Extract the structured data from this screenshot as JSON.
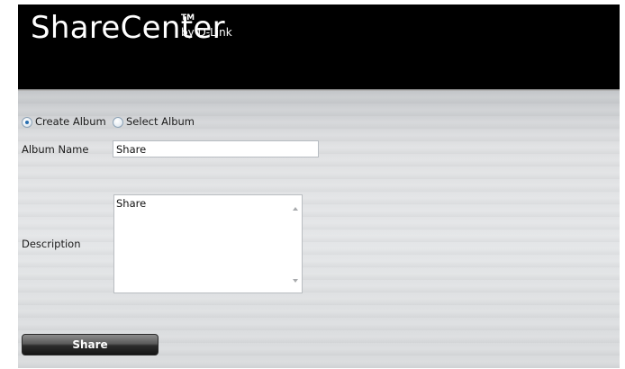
{
  "header": {
    "logo_main": "ShareCenter",
    "logo_tm": "TM",
    "logo_by": "by D-Link"
  },
  "album_mode": {
    "create_label": "Create Album",
    "select_label": "Select Album",
    "selected": "Create Album"
  },
  "form": {
    "album_name_label": "Album Name",
    "album_name_value": "Share",
    "description_label": "Description",
    "description_value": "Share"
  },
  "actions": {
    "share_label": "Share"
  }
}
